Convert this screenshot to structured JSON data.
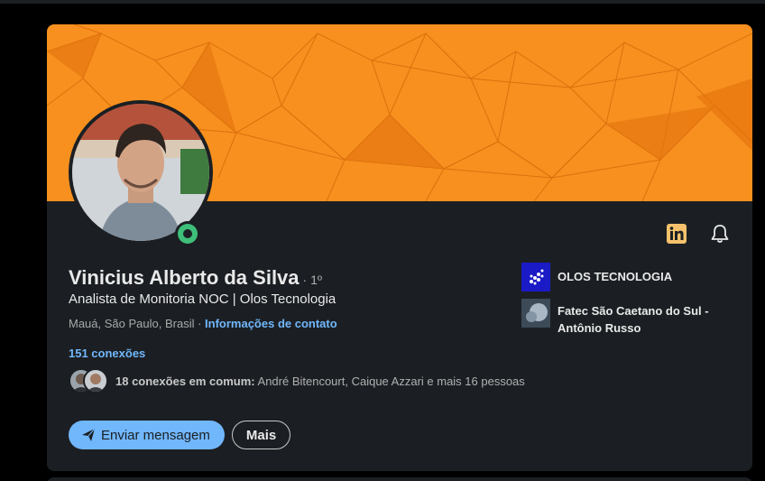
{
  "profile": {
    "name": "Vinicius Alberto da Silva",
    "degree": "· 1º",
    "headline": "Analista de Monitoria NOC | Olos Tecnologia",
    "location": "Mauá, São Paulo, Brasil",
    "location_separator": " · ",
    "contact_link": "Informações de contato",
    "connections": "151 conexões",
    "mutual_count": "18 conexões em comum:",
    "mutual_names": " André Bitencourt, Caique Azzari e mais 16 pessoas"
  },
  "actions": {
    "message_label": "Enviar mensagem",
    "more_label": "Mais"
  },
  "organizations": [
    {
      "name": "OLOS TECNOLOGIA",
      "icon": "olos-logo"
    },
    {
      "name": "Fatec São Caetano do Sul - Antônio Russo",
      "icon": "fatec-logo"
    }
  ],
  "icons": {
    "linkedin": "linkedin-icon",
    "bell": "bell-icon",
    "online": "online-status-icon",
    "send": "send-icon"
  },
  "colors": {
    "banner": "#f7901e",
    "card": "#1b1f23",
    "link": "#71b7fb",
    "online": "#3fbe7a",
    "linkedin_badge": "#f5c26b"
  }
}
